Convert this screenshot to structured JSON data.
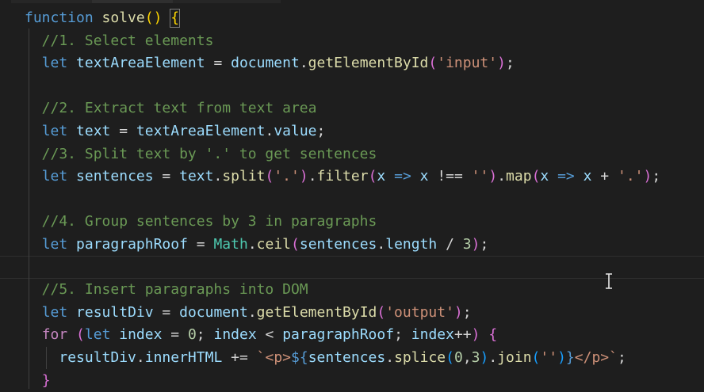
{
  "editor": {
    "colors": {
      "background": "#1e1e1e",
      "keyword": "#569cd6",
      "function_name": "#dcdcaa",
      "variable": "#9cdcfe",
      "string": "#ce9178",
      "comment": "#6a9955",
      "number": "#b5cea8",
      "control": "#c586c0",
      "punctuation": "#d4d4d4",
      "bracket_gold": "#ffd700",
      "bracket_purple": "#da70d6",
      "bracket_blue": "#179fff",
      "class_name": "#4ec9b0"
    },
    "lines": [
      [
        {
          "t": "function",
          "c": "keyword"
        },
        {
          "t": " ",
          "c": "punctuation"
        },
        {
          "t": "solve",
          "c": "function_name"
        },
        {
          "t": "()",
          "c": "bracket_gold"
        },
        {
          "t": " ",
          "c": "punctuation"
        },
        {
          "t": "{",
          "c": "bracket_gold",
          "box": true
        }
      ],
      [
        {
          "t": "  //1. Select elements",
          "c": "comment"
        }
      ],
      [
        {
          "t": "  ",
          "c": "punctuation"
        },
        {
          "t": "let",
          "c": "keyword"
        },
        {
          "t": " ",
          "c": "punctuation"
        },
        {
          "t": "textAreaElement",
          "c": "variable"
        },
        {
          "t": " = ",
          "c": "punctuation"
        },
        {
          "t": "document",
          "c": "variable"
        },
        {
          "t": ".",
          "c": "punctuation"
        },
        {
          "t": "getElementById",
          "c": "function_name"
        },
        {
          "t": "(",
          "c": "bracket_purple"
        },
        {
          "t": "'input'",
          "c": "string"
        },
        {
          "t": ")",
          "c": "bracket_purple"
        },
        {
          "t": ";",
          "c": "punctuation"
        }
      ],
      [],
      [
        {
          "t": "  //2. Extract text from text area",
          "c": "comment"
        }
      ],
      [
        {
          "t": "  ",
          "c": "punctuation"
        },
        {
          "t": "let",
          "c": "keyword"
        },
        {
          "t": " ",
          "c": "punctuation"
        },
        {
          "t": "text",
          "c": "variable"
        },
        {
          "t": " = ",
          "c": "punctuation"
        },
        {
          "t": "textAreaElement",
          "c": "variable"
        },
        {
          "t": ".",
          "c": "punctuation"
        },
        {
          "t": "value",
          "c": "variable"
        },
        {
          "t": ";",
          "c": "punctuation"
        }
      ],
      [
        {
          "t": "  //3. Split text by '.' to get sentences",
          "c": "comment"
        }
      ],
      [
        {
          "t": "  ",
          "c": "punctuation"
        },
        {
          "t": "let",
          "c": "keyword"
        },
        {
          "t": " ",
          "c": "punctuation"
        },
        {
          "t": "sentences",
          "c": "variable"
        },
        {
          "t": " = ",
          "c": "punctuation"
        },
        {
          "t": "text",
          "c": "variable"
        },
        {
          "t": ".",
          "c": "punctuation"
        },
        {
          "t": "split",
          "c": "function_name"
        },
        {
          "t": "(",
          "c": "bracket_purple"
        },
        {
          "t": "'.'",
          "c": "string"
        },
        {
          "t": ")",
          "c": "bracket_purple"
        },
        {
          "t": ".",
          "c": "punctuation"
        },
        {
          "t": "filter",
          "c": "function_name"
        },
        {
          "t": "(",
          "c": "bracket_purple"
        },
        {
          "t": "x",
          "c": "variable"
        },
        {
          "t": " ",
          "c": "punctuation"
        },
        {
          "t": "=>",
          "c": "keyword"
        },
        {
          "t": " ",
          "c": "punctuation"
        },
        {
          "t": "x",
          "c": "variable"
        },
        {
          "t": " !== ",
          "c": "punctuation"
        },
        {
          "t": "''",
          "c": "string"
        },
        {
          "t": ")",
          "c": "bracket_purple"
        },
        {
          "t": ".",
          "c": "punctuation"
        },
        {
          "t": "map",
          "c": "function_name"
        },
        {
          "t": "(",
          "c": "bracket_purple"
        },
        {
          "t": "x",
          "c": "variable"
        },
        {
          "t": " ",
          "c": "punctuation"
        },
        {
          "t": "=>",
          "c": "keyword"
        },
        {
          "t": " ",
          "c": "punctuation"
        },
        {
          "t": "x",
          "c": "variable"
        },
        {
          "t": " + ",
          "c": "punctuation"
        },
        {
          "t": "'.'",
          "c": "string"
        },
        {
          "t": ")",
          "c": "bracket_purple"
        },
        {
          "t": ";",
          "c": "punctuation"
        }
      ],
      [],
      [
        {
          "t": "  //4. Group sentences by 3 in paragraphs",
          "c": "comment"
        }
      ],
      [
        {
          "t": "  ",
          "c": "punctuation"
        },
        {
          "t": "let",
          "c": "keyword"
        },
        {
          "t": " ",
          "c": "punctuation"
        },
        {
          "t": "paragraphRoof",
          "c": "variable"
        },
        {
          "t": " = ",
          "c": "punctuation"
        },
        {
          "t": "Math",
          "c": "class_name"
        },
        {
          "t": ".",
          "c": "punctuation"
        },
        {
          "t": "ceil",
          "c": "function_name"
        },
        {
          "t": "(",
          "c": "bracket_purple"
        },
        {
          "t": "sentences",
          "c": "variable"
        },
        {
          "t": ".",
          "c": "punctuation"
        },
        {
          "t": "length",
          "c": "variable"
        },
        {
          "t": " / ",
          "c": "punctuation"
        },
        {
          "t": "3",
          "c": "number"
        },
        {
          "t": ")",
          "c": "bracket_purple"
        },
        {
          "t": ";",
          "c": "punctuation"
        }
      ],
      [],
      [
        {
          "t": "  //5. Insert paragraphs into DOM",
          "c": "comment"
        }
      ],
      [
        {
          "t": "  ",
          "c": "punctuation"
        },
        {
          "t": "let",
          "c": "keyword"
        },
        {
          "t": " ",
          "c": "punctuation"
        },
        {
          "t": "resultDiv",
          "c": "variable"
        },
        {
          "t": " = ",
          "c": "punctuation"
        },
        {
          "t": "document",
          "c": "variable"
        },
        {
          "t": ".",
          "c": "punctuation"
        },
        {
          "t": "getElementById",
          "c": "function_name"
        },
        {
          "t": "(",
          "c": "bracket_purple"
        },
        {
          "t": "'output'",
          "c": "string"
        },
        {
          "t": ")",
          "c": "bracket_purple"
        },
        {
          "t": ";",
          "c": "punctuation"
        }
      ],
      [
        {
          "t": "  ",
          "c": "punctuation"
        },
        {
          "t": "for",
          "c": "control"
        },
        {
          "t": " ",
          "c": "punctuation"
        },
        {
          "t": "(",
          "c": "bracket_purple"
        },
        {
          "t": "let",
          "c": "keyword"
        },
        {
          "t": " ",
          "c": "punctuation"
        },
        {
          "t": "index",
          "c": "variable"
        },
        {
          "t": " = ",
          "c": "punctuation"
        },
        {
          "t": "0",
          "c": "number"
        },
        {
          "t": "; ",
          "c": "punctuation"
        },
        {
          "t": "index",
          "c": "variable"
        },
        {
          "t": " < ",
          "c": "punctuation"
        },
        {
          "t": "paragraphRoof",
          "c": "variable"
        },
        {
          "t": "; ",
          "c": "punctuation"
        },
        {
          "t": "index",
          "c": "variable"
        },
        {
          "t": "++",
          "c": "punctuation"
        },
        {
          "t": ")",
          "c": "bracket_purple"
        },
        {
          "t": " ",
          "c": "punctuation"
        },
        {
          "t": "{",
          "c": "bracket_purple"
        }
      ],
      [
        {
          "t": "    ",
          "c": "punctuation"
        },
        {
          "t": "resultDiv",
          "c": "variable"
        },
        {
          "t": ".",
          "c": "punctuation"
        },
        {
          "t": "innerHTML",
          "c": "variable"
        },
        {
          "t": " += ",
          "c": "punctuation"
        },
        {
          "t": "`<p>",
          "c": "string"
        },
        {
          "t": "${",
          "c": "keyword"
        },
        {
          "t": "sentences",
          "c": "variable"
        },
        {
          "t": ".",
          "c": "punctuation"
        },
        {
          "t": "splice",
          "c": "function_name"
        },
        {
          "t": "(",
          "c": "bracket_blue"
        },
        {
          "t": "0",
          "c": "number"
        },
        {
          "t": ",",
          "c": "punctuation"
        },
        {
          "t": "3",
          "c": "number"
        },
        {
          "t": ")",
          "c": "bracket_blue"
        },
        {
          "t": ".",
          "c": "punctuation"
        },
        {
          "t": "join",
          "c": "function_name"
        },
        {
          "t": "(",
          "c": "bracket_blue"
        },
        {
          "t": "''",
          "c": "string"
        },
        {
          "t": ")",
          "c": "bracket_blue"
        },
        {
          "t": "}",
          "c": "keyword"
        },
        {
          "t": "</p>`",
          "c": "string"
        },
        {
          "t": ";",
          "c": "punctuation"
        }
      ],
      [
        {
          "t": "  ",
          "c": "punctuation"
        },
        {
          "t": "}",
          "c": "bracket_purple"
        }
      ]
    ]
  }
}
